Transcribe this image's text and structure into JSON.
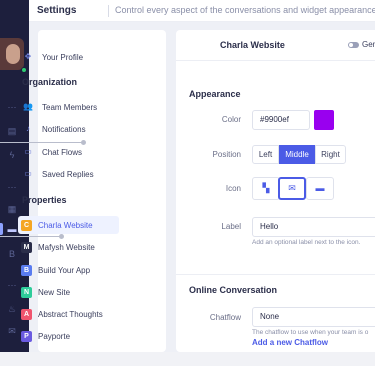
{
  "header": {
    "title": "Settings",
    "description": "Control every aspect of the conversations and widget appearance"
  },
  "rail": {
    "icons": [
      "more-icon",
      "inbox-icon",
      "activity-icon",
      "more-icon",
      "layout-icon",
      "chat-icon",
      "billing-icon",
      "more-icon",
      "fire-icon",
      "mail-icon"
    ]
  },
  "nav": {
    "profile": "Your Profile",
    "org_title": "Organization",
    "org_items": [
      "Team Members",
      "Notifications",
      "Chat Flows",
      "Saved Replies"
    ],
    "prop_title": "Properties",
    "properties": [
      {
        "letter": "C",
        "label": "Charla Website",
        "color": "#f5a623",
        "active": true
      },
      {
        "letter": "M",
        "label": "Mafysh Website",
        "color": "#2b2e4a"
      },
      {
        "letter": "B",
        "label": "Build Your App",
        "color": "#5a7cf0"
      },
      {
        "letter": "N",
        "label": "New Site",
        "color": "#2ecc9a"
      },
      {
        "letter": "A",
        "label": "Abstract Thoughts",
        "color": "#f0546e"
      },
      {
        "letter": "P",
        "label": "Payporte",
        "color": "#6a5ae0"
      }
    ]
  },
  "panel": {
    "title": "Charla Website",
    "toggle_label": "General",
    "appearance_title": "Appearance",
    "color_label": "Color",
    "color_value": "#9900ef",
    "position_label": "Position",
    "positions": [
      "Left",
      "Middle",
      "Right"
    ],
    "selected_position": "Middle",
    "icon_label": "Icon",
    "label_label": "Label",
    "label_value": "Hello",
    "label_help": "Add an optional label next to the icon.",
    "online_title": "Online Conversation",
    "chatflow_label": "Chatflow",
    "chatflow_value": "None",
    "chatflow_help": "The chatflow to use when your team is o",
    "chatflow_link": "Add a new Chatflow"
  },
  "colors": {
    "accent": "#4b5be6",
    "widget_color": "#9900ef",
    "rail_bg": "#1d1f3d"
  }
}
